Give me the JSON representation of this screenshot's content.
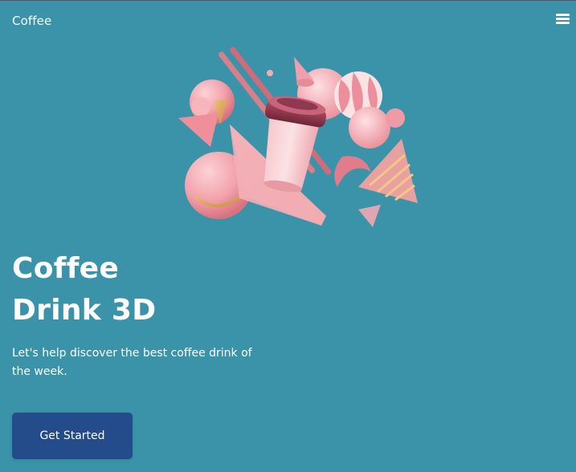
{
  "navbar": {
    "brand": "Coffee",
    "menu_icon": "hamburger-menu-icon"
  },
  "hero": {
    "illustration": "coffee-cup-3d-illustration",
    "title_line1": "Coffee",
    "title_line2": "Drink 3D",
    "subtitle": "Let's help discover the best coffee drink of the week.",
    "cta_label": "Get Started"
  },
  "colors": {
    "background": "#3a93a8",
    "button": "#244b8a",
    "text": "#ffffff",
    "illustration_pink": "#f2a8b0",
    "illustration_dark": "#8a3448"
  }
}
